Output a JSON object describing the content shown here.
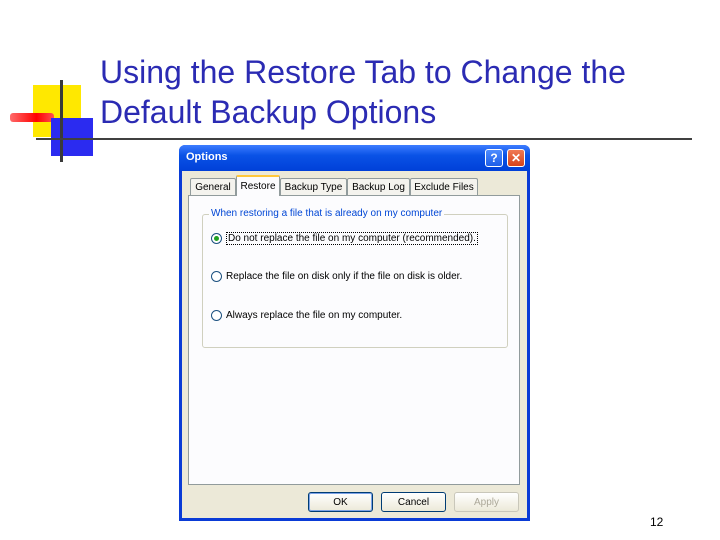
{
  "slide": {
    "title": "Using the Restore Tab to Change the Default Backup Options",
    "number": "12"
  },
  "dialog": {
    "title": "Options",
    "help_symbol": "?",
    "close_symbol": "✕",
    "tabs": [
      {
        "label": "General"
      },
      {
        "label": "Restore"
      },
      {
        "label": "Backup Type"
      },
      {
        "label": "Backup Log"
      },
      {
        "label": "Exclude Files"
      }
    ],
    "active_tab": "Restore",
    "group": {
      "label": "When restoring a file that is already on my computer",
      "options": [
        {
          "label": "Do not replace the file on my computer (recommended).",
          "checked": true
        },
        {
          "label": "Replace the file on disk only if the file on disk is older.",
          "checked": false
        },
        {
          "label": "Always replace the file on my computer.",
          "checked": false
        }
      ]
    },
    "buttons": {
      "ok": "OK",
      "cancel": "Cancel",
      "apply": "Apply"
    }
  },
  "colors": {
    "title_text": "#2b2bb3",
    "deco_yellow": "#ffe800",
    "deco_red": "#ff0000",
    "deco_blue": "#2b2bf0",
    "xp_titlebar": "#0a52e6",
    "xp_face": "#ece9d8"
  },
  "icons": {
    "help": "question-mark-icon",
    "close": "close-x-icon"
  }
}
